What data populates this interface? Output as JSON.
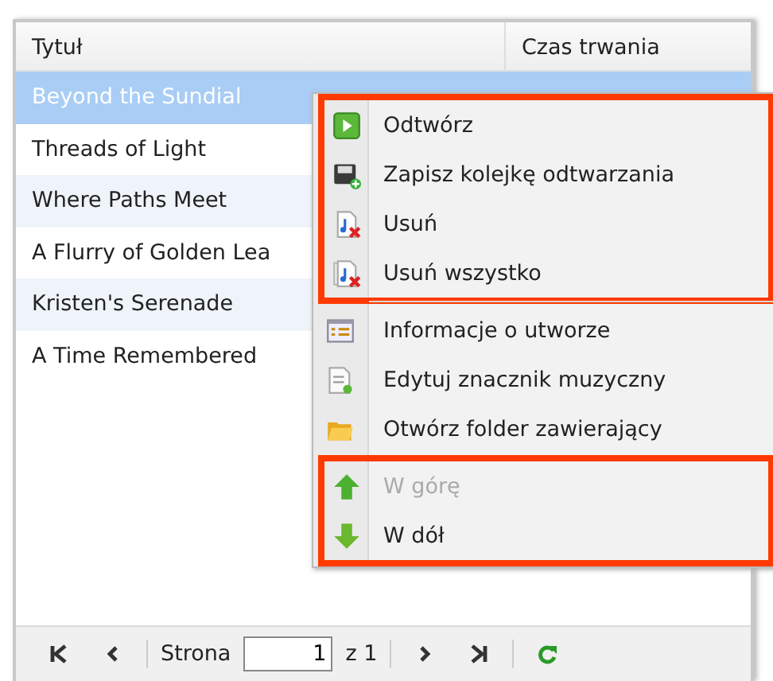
{
  "table": {
    "columns": [
      "Tytuł",
      "Czas trwania"
    ],
    "rows": [
      {
        "title": "Beyond the Sundial",
        "selected": true
      },
      {
        "title": "Threads of Light",
        "selected": false
      },
      {
        "title": "Where Paths Meet",
        "selected": false
      },
      {
        "title": "A Flurry of Golden Lea",
        "selected": false
      },
      {
        "title": "Kristen's Serenade",
        "selected": false
      },
      {
        "title": "A Time Remembered",
        "selected": false
      }
    ]
  },
  "context_menu": {
    "groups": [
      {
        "highlighted": true,
        "items": [
          {
            "label": "Odtwórz",
            "kind": "play",
            "disabled": false
          },
          {
            "label": "Zapisz kolejkę odtwarzania",
            "kind": "save",
            "disabled": false
          },
          {
            "label": "Usuń",
            "kind": "remove",
            "disabled": false
          },
          {
            "label": "Usuń wszystko",
            "kind": "removeall",
            "disabled": false
          }
        ]
      },
      {
        "highlighted": false,
        "items": [
          {
            "label": "Informacje o utworze",
            "kind": "info",
            "disabled": false
          },
          {
            "label": "Edytuj znacznik muzyczny",
            "kind": "edit",
            "disabled": false
          },
          {
            "label": "Otwórz folder zawierający",
            "kind": "folder",
            "disabled": false
          }
        ]
      },
      {
        "highlighted": true,
        "items": [
          {
            "label": "W górę",
            "kind": "up",
            "disabled": true
          },
          {
            "label": "W dół",
            "kind": "down",
            "disabled": false
          }
        ]
      }
    ]
  },
  "pager": {
    "page_label": "Strona",
    "page": "1",
    "of_label": "z 1"
  }
}
